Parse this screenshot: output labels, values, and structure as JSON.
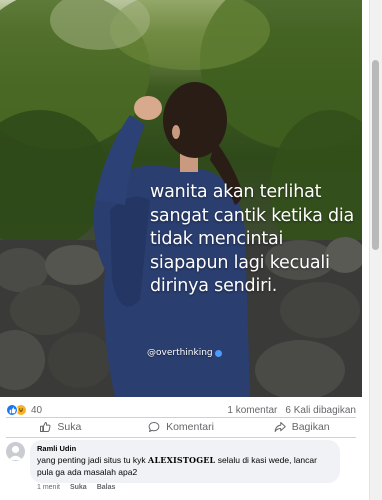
{
  "post": {
    "quote": "wanita akan terlihat sangat cantik ketika dia tidak mencintai siapapun lagi kecuali dirinya sendiri.",
    "watermark": "@overthinking"
  },
  "stats": {
    "reaction_count": "40",
    "comments": "1 komentar",
    "shares": "6 Kali dibagikan"
  },
  "actions": {
    "like": "Suka",
    "comment": "Komentari",
    "share": "Bagikan"
  },
  "comment": {
    "author": "Ramli Udin",
    "text_before": "yang penting jadi situs tu kyk ",
    "brand": "ALEXISTOGEL",
    "text_after": " selalu di kasi wede, lancar pula ga ada masalah apa2",
    "time": "1 menit",
    "like": "Suka",
    "reply": "Balas"
  },
  "colors": {
    "like_blue": "#1877f2",
    "haha_yellow": "#f7b125",
    "muted_text": "#65676b",
    "bubble_bg": "#f0f2f5"
  },
  "icons": {
    "like": "thumbs-up-icon",
    "comment": "speech-bubble-icon",
    "share": "share-arrow-icon"
  }
}
